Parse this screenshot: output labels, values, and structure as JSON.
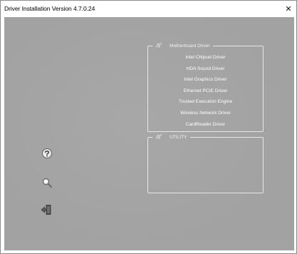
{
  "window": {
    "title": "Driver Installation Version 4.7.0.24",
    "close_glyph": "✕"
  },
  "motherboard_group": {
    "title": "Motherboard Driver",
    "icon": "installer-icon",
    "items": [
      {
        "label": "Intel Chipset Driver"
      },
      {
        "label": "HDA Sound Driver"
      },
      {
        "label": "Intel Graphics Driver"
      },
      {
        "label": "Ethernet PCIE Driver"
      },
      {
        "label": "Trusted Execution Engine"
      },
      {
        "label": "Wireless Network Driver"
      },
      {
        "label": "CardReader Driver"
      }
    ]
  },
  "utility_group": {
    "title": "UTILITY",
    "icon": "installer-icon"
  },
  "side_icons": [
    "help-icon",
    "search-icon",
    "exit-icon"
  ],
  "colors": {
    "background": "#a2a2a2",
    "border": "#e6e6e6",
    "text": "#ffffff"
  }
}
